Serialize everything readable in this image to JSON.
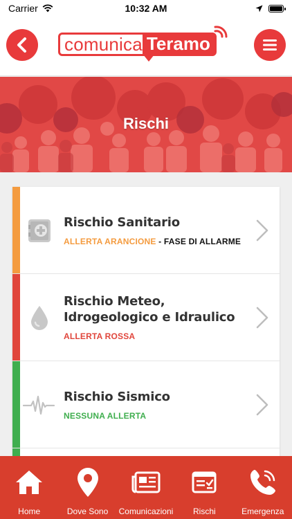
{
  "status_bar": {
    "carrier": "Carrier",
    "time": "10:32 AM"
  },
  "header": {
    "logo_part1": "comunica",
    "logo_part2": "Teramo"
  },
  "banner": {
    "title": "Rischi"
  },
  "risks": [
    {
      "title": "Rischio Sanitario",
      "status": "ALLERTA ARANCIONE",
      "phase": " - FASE DI ALLARME",
      "color": "#f49b3f",
      "icon": "medical-kit-icon"
    },
    {
      "title": "Rischio Meteo, Idrogeologico e Idraulico",
      "status": "ALLERTA ROSSA",
      "phase": "",
      "color": "#e0453b",
      "icon": "water-drop-icon"
    },
    {
      "title": "Rischio Sismico",
      "status": "NESSUNA ALLERTA",
      "phase": "",
      "color": "#3fae4e",
      "icon": "seismograph-icon"
    }
  ],
  "bottom_nav": [
    {
      "label": "Home",
      "icon": "home-icon"
    },
    {
      "label": "Dove Sono",
      "icon": "location-pin-icon"
    },
    {
      "label": "Comunicazioni",
      "icon": "newspaper-icon"
    },
    {
      "label": "Rischi",
      "icon": "checklist-icon"
    },
    {
      "label": "Emergenza",
      "icon": "phone-icon"
    }
  ],
  "colors": {
    "brand_red": "#e83a3b",
    "nav_bg": "#d83e2d"
  }
}
